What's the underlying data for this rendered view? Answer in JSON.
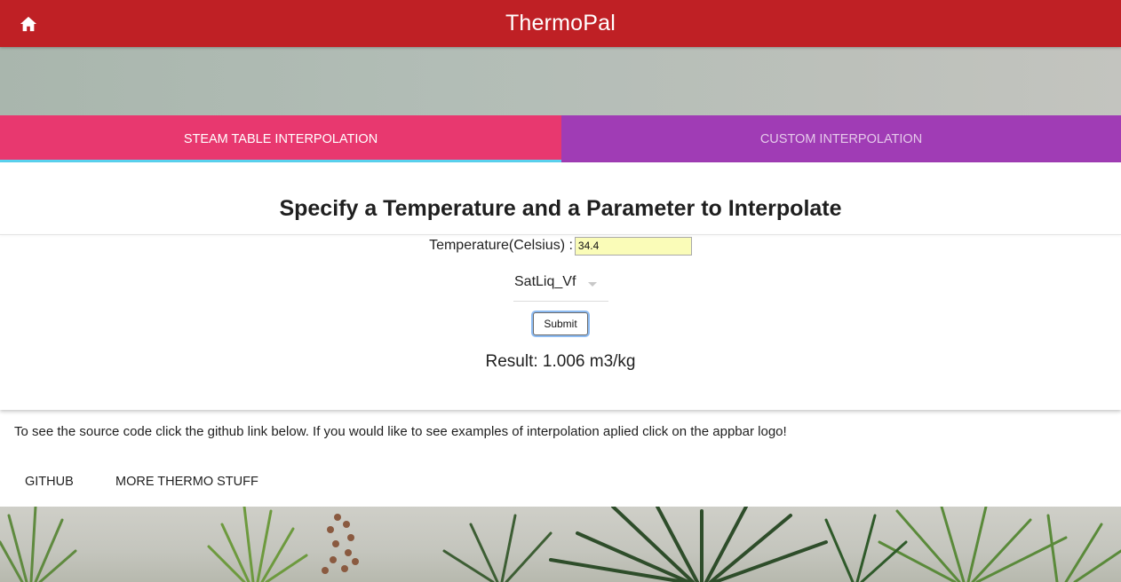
{
  "app": {
    "title": "ThermoPal"
  },
  "tabs": [
    {
      "label": "STEAM TABLE INTERPOLATION",
      "active": true
    },
    {
      "label": "CUSTOM INTERPOLATION",
      "active": false
    }
  ],
  "form": {
    "heading": "Specify a Temperature and a Parameter to Interpolate",
    "temperature_label": "Temperature(Celsius) :",
    "temperature_value": "34.4",
    "parameter_selected": "SatLiq_Vf",
    "submit_label": "Submit",
    "result_text": "Result: 1.006 m3/kg"
  },
  "footer": {
    "info_text": "To see the source code click the github link below. If you would like to see examples of interpolation aplied click on the appbar logo!",
    "github_label": "GITHUB",
    "more_label": "MORE THERMO STUFF"
  },
  "colors": {
    "appbar": "#bf2025",
    "tab_active": "#e8386f",
    "tab_inactive": "#a03cb5",
    "tab_indicator": "#5ad3f0",
    "input_bg": "#fafcb8"
  },
  "icons": {
    "home": "home-icon",
    "caret": "caret-down-icon"
  }
}
